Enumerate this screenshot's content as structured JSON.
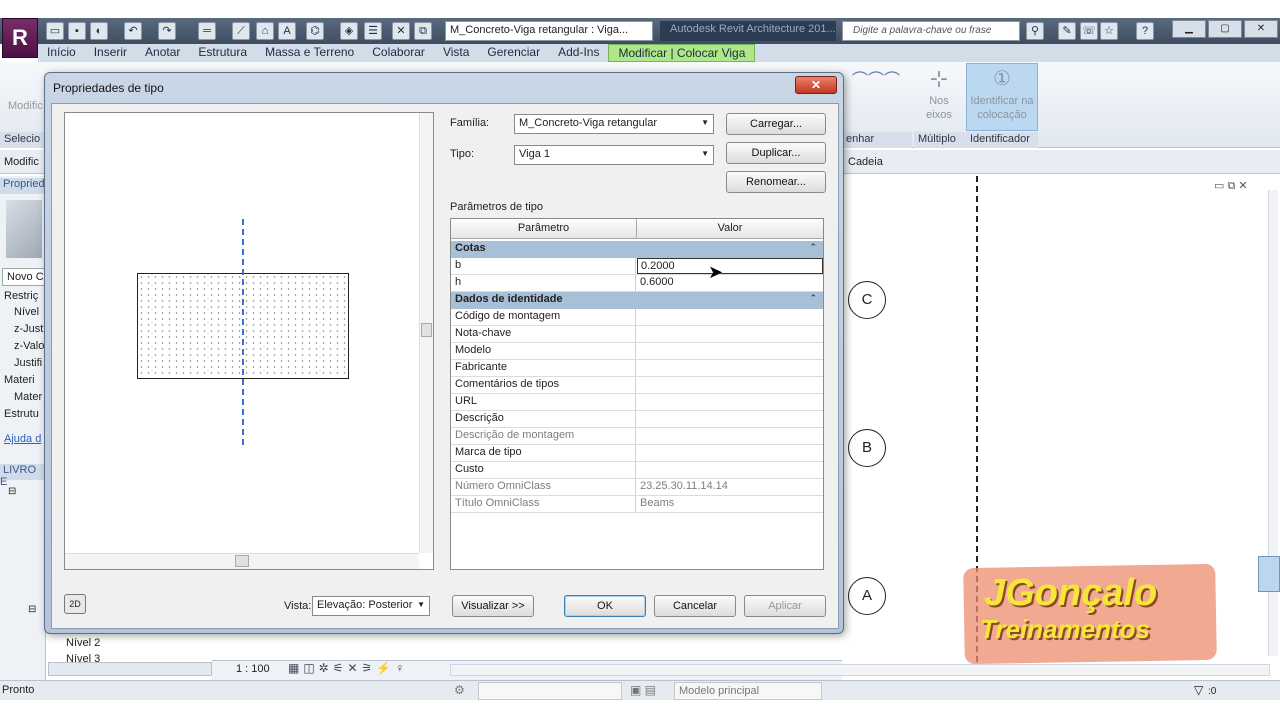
{
  "app": {
    "document_selector": "M_Concreto-Viga retangular : Viga...",
    "title": "Autodesk Revit Architecture 201...",
    "search_placeholder": "Digite a palavra-chave ou frase"
  },
  "ribbon": {
    "tabs": [
      "Início",
      "Inserir",
      "Anotar",
      "Estrutura",
      "Massa e Terreno",
      "Colaborar",
      "Vista",
      "Gerenciar",
      "Add-Ins",
      "Modificar | Colocar Viga"
    ],
    "active_tab": "Modificar | Colocar Viga",
    "modify_label": "Modific",
    "select_group": "Selecio",
    "draw_group": "enhar",
    "multiple_group": "Múltiplo",
    "identifier_group": "Identificador",
    "on_axes_label": "Nos eixos",
    "identify_label": "Identificar na colocação",
    "chain_label": "Cadeia"
  },
  "left_panel": {
    "options_label": "Modific",
    "properties_label": "Propried",
    "new_label": "Novo C",
    "rows": [
      "Restriç",
      "Nível",
      "z-Justi",
      "z-Valo",
      "Justifi",
      "Materi",
      "Mater",
      "Estrutu"
    ],
    "help_label": "Ajuda d",
    "browser_label": "LIVRO E",
    "level_items": [
      "Nível 2",
      "Nível 3"
    ]
  },
  "dialog": {
    "title": "Propriedades de tipo",
    "family_label": "Família:",
    "family_value": "M_Concreto-Viga retangular",
    "type_label": "Tipo:",
    "type_value": "Viga 1",
    "load_button": "Carregar...",
    "duplicate_button": "Duplicar...",
    "rename_button": "Renomear...",
    "type_params_label": "Parâmetros de tipo",
    "col_param": "Parâmetro",
    "col_value": "Valor",
    "group_dims": "Cotas",
    "dims": [
      {
        "name": "b",
        "value": "0.2000"
      },
      {
        "name": "h",
        "value": "0.6000"
      }
    ],
    "group_identity": "Dados de identidade",
    "identity": [
      {
        "name": "Código de montagem",
        "value": ""
      },
      {
        "name": "Nota-chave",
        "value": ""
      },
      {
        "name": "Modelo",
        "value": ""
      },
      {
        "name": "Fabricante",
        "value": ""
      },
      {
        "name": "Comentários de tipos",
        "value": ""
      },
      {
        "name": "URL",
        "value": ""
      },
      {
        "name": "Descrição",
        "value": ""
      },
      {
        "name": "Descrição de montagem",
        "value": ""
      },
      {
        "name": "Marca de tipo",
        "value": ""
      },
      {
        "name": "Custo",
        "value": ""
      },
      {
        "name": "Número OmniClass",
        "value": "23.25.30.11.14.14"
      },
      {
        "name": "Título OmniClass",
        "value": "Beams"
      }
    ],
    "view_label": "Vista:",
    "view_value": "Elevação: Posterior",
    "preview_button": "Visualizar >>",
    "ok_button": "OK",
    "cancel_button": "Cancelar",
    "apply_button": "Aplicar"
  },
  "drawing": {
    "grid_labels": [
      "C",
      "B",
      "A"
    ],
    "scale": "1 : 100"
  },
  "status": {
    "text": "Pronto",
    "model": "Modelo principal",
    "filter_count": ":0"
  },
  "watermark": {
    "line1": "JGonçalo",
    "line2": "Treinamentos"
  }
}
